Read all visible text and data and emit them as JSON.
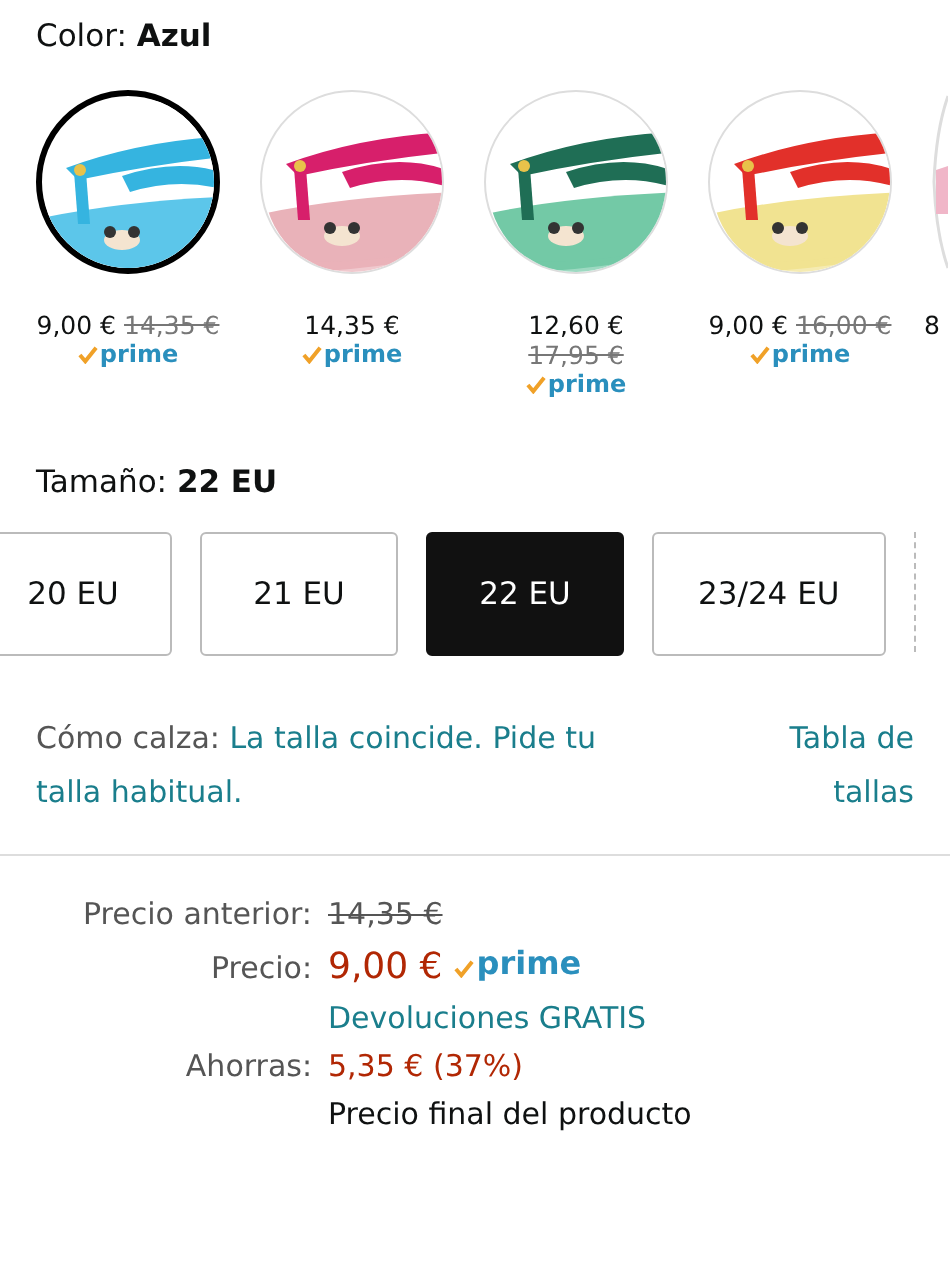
{
  "color_selector": {
    "label": "Color:",
    "value": "Azul",
    "swatches": [
      {
        "kind": "inline",
        "selected": true,
        "price": "9,00 €",
        "old_price": "14,35 €",
        "prime": true,
        "prime_label": "prime"
      },
      {
        "kind": "inline",
        "selected": false,
        "price": "14,35 €",
        "prime": true,
        "prime_label": "prime"
      },
      {
        "kind": "stacked",
        "selected": false,
        "price": "12,60 €",
        "old_price": "17,95 €",
        "prime": true,
        "prime_label": "prime"
      },
      {
        "kind": "inline",
        "selected": false,
        "price": "9,00 €",
        "old_price": "16,00 €",
        "prime": true,
        "prime_label": "prime"
      },
      {
        "kind": "partial",
        "selected": false,
        "price": "8"
      }
    ]
  },
  "size_selector": {
    "label": "Tamaño:",
    "value": "22 EU",
    "options": [
      {
        "label": "20 EU",
        "selected": false
      },
      {
        "label": "21 EU",
        "selected": false
      },
      {
        "label": "22 EU",
        "selected": true
      },
      {
        "label": "23/24 EU",
        "selected": false
      }
    ]
  },
  "fit": {
    "label": "Cómo calza:",
    "text": "La talla coincide. Pide tu talla habitual.",
    "size_chart_link": "Tabla de tallas"
  },
  "pricing": {
    "previous_label": "Precio anterior:",
    "previous_price": "14,35 €",
    "price_label": "Precio:",
    "price": "9,00 €",
    "prime": true,
    "prime_label": "prime",
    "returns": "Devoluciones GRATIS",
    "savings_label": "Ahorras:",
    "savings": "5,35 € (37%)",
    "note": "Precio final del producto"
  }
}
